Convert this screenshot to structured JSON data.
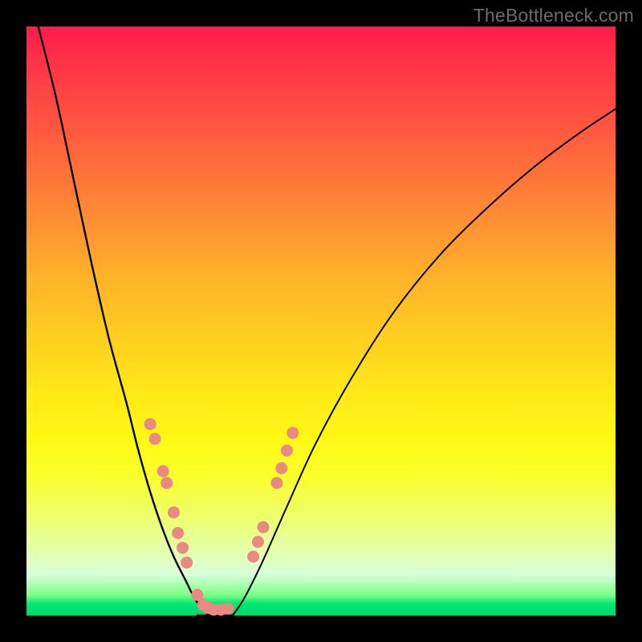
{
  "watermark": "TheBottleneck.com",
  "chart_data": {
    "type": "line",
    "title": "",
    "xlabel": "",
    "ylabel": "",
    "xlim": [
      0,
      100
    ],
    "ylim": [
      0,
      100
    ],
    "grid": false,
    "legend": false,
    "background": "rainbow-gradient-red-to-green",
    "series": [
      {
        "name": "left-curve",
        "x": [
          2,
          5,
          8,
          11,
          14,
          17,
          19,
          21,
          23,
          25,
          27,
          28.5,
          30,
          31
        ],
        "values": [
          100,
          88,
          74,
          60,
          47,
          36,
          28,
          21,
          15,
          10,
          6,
          3,
          1,
          0
        ]
      },
      {
        "name": "right-curve",
        "x": [
          35,
          37,
          40,
          44,
          49,
          55,
          62,
          70,
          78,
          86,
          94,
          100
        ],
        "values": [
          0,
          3,
          9,
          18,
          29,
          40,
          51,
          61,
          69,
          76,
          82,
          86
        ]
      },
      {
        "name": "bottom-plateau",
        "x": [
          29,
          31,
          33,
          35
        ],
        "values": [
          0,
          0,
          0,
          0
        ]
      }
    ],
    "markers": [
      {
        "name": "left-curve-dots",
        "color": "#e98a82",
        "points": [
          {
            "x": 21.0,
            "y": 32.5
          },
          {
            "x": 21.8,
            "y": 30.0
          },
          {
            "x": 23.2,
            "y": 24.5
          },
          {
            "x": 23.8,
            "y": 22.5
          },
          {
            "x": 25.0,
            "y": 17.5
          },
          {
            "x": 25.7,
            "y": 14.0
          },
          {
            "x": 26.5,
            "y": 11.5
          },
          {
            "x": 27.2,
            "y": 9.0
          },
          {
            "x": 29.0,
            "y": 3.5
          },
          {
            "x": 30.0,
            "y": 1.8
          },
          {
            "x": 30.8,
            "y": 1.3
          },
          {
            "x": 31.8,
            "y": 1.0
          },
          {
            "x": 33.0,
            "y": 1.0
          },
          {
            "x": 34.2,
            "y": 1.2
          }
        ]
      },
      {
        "name": "right-curve-dots",
        "color": "#e98a82",
        "points": [
          {
            "x": 38.5,
            "y": 10.0
          },
          {
            "x": 39.3,
            "y": 12.5
          },
          {
            "x": 40.2,
            "y": 15.0
          },
          {
            "x": 42.5,
            "y": 22.5
          },
          {
            "x": 43.3,
            "y": 25.0
          },
          {
            "x": 44.2,
            "y": 28.0
          },
          {
            "x": 45.2,
            "y": 31.0
          }
        ]
      }
    ]
  }
}
